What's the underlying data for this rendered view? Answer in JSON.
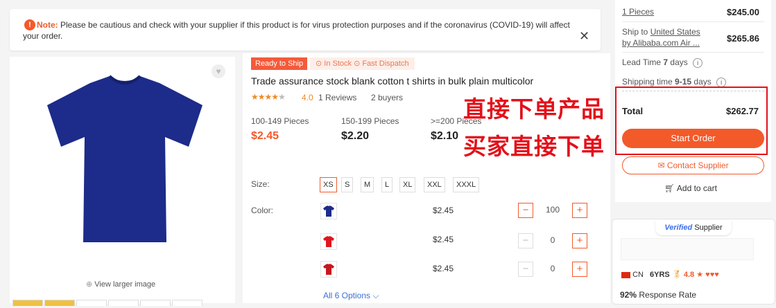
{
  "notice": {
    "label": "Note:",
    "text": "Please be cautious and check with your supplier if this product is for virus protection purposes and if the coronavirus (COVID-19) will affect your order."
  },
  "gallery": {
    "view_larger": "View larger image",
    "main_color": "#1d2b8a"
  },
  "product": {
    "badge_ready": "Ready to Ship",
    "badge_stock": "⊙ In Stock ⊙ Fast Dispatch",
    "title": "Trade assurance stock blank cotton t shirts in bulk plain multicolor",
    "rating": "4.0",
    "reviews": "1 Reviews",
    "buyers": "2 buyers"
  },
  "tiers": [
    {
      "label": "100-149 Pieces",
      "price": "$2.45"
    },
    {
      "label": "150-199 Pieces",
      "price": "$2.20"
    },
    {
      "label": ">=200 Pieces",
      "price": "$2.10"
    }
  ],
  "overlay": {
    "line1": "直接下单产品",
    "line2": "买家直接下单"
  },
  "size": {
    "label": "Size:",
    "options": [
      "XS",
      "S",
      "M",
      "L",
      "XL",
      "XXL",
      "XXXL"
    ],
    "selected": "XS"
  },
  "color": {
    "label": "Color:",
    "rows": [
      {
        "swatch": "#1d2b8a",
        "price": "$2.45",
        "qty": "100"
      },
      {
        "swatch": "#e0141e",
        "price": "$2.45",
        "qty": "0"
      },
      {
        "swatch": "#c8161e",
        "price": "$2.45",
        "qty": "0"
      }
    ]
  },
  "all_options": "All 6 Options",
  "order": {
    "pieces_link": "1 Pieces",
    "pieces_value": "$245.00",
    "ship_to_prefix": "Ship to ",
    "ship_to_country": "United States",
    "ship_via": "by Alibaba.com Air ...",
    "ship_value": "$265.86",
    "lead_time_label": "Lead Time ",
    "lead_time_value": "7",
    "lead_time_unit": " days",
    "shipping_time_label": "Shipping time ",
    "shipping_time_value": "9-15",
    "shipping_time_unit": " days",
    "total_label": "Total",
    "total_value": "$262.77",
    "start_order": "Start Order",
    "contact_supplier": "Contact Supplier",
    "add_to_cart": "Add to cart"
  },
  "supplier": {
    "verified": "Verified",
    "verified_suffix": " Supplier",
    "country": "CN",
    "years": "6YRS",
    "rating": "4.8",
    "response_rate_value": "92%",
    "response_rate_label": " Response Rate"
  },
  "colors": {
    "accent": "#f25a2a",
    "overlay_red": "#e3101a",
    "link_blue": "#3b6fd6"
  }
}
